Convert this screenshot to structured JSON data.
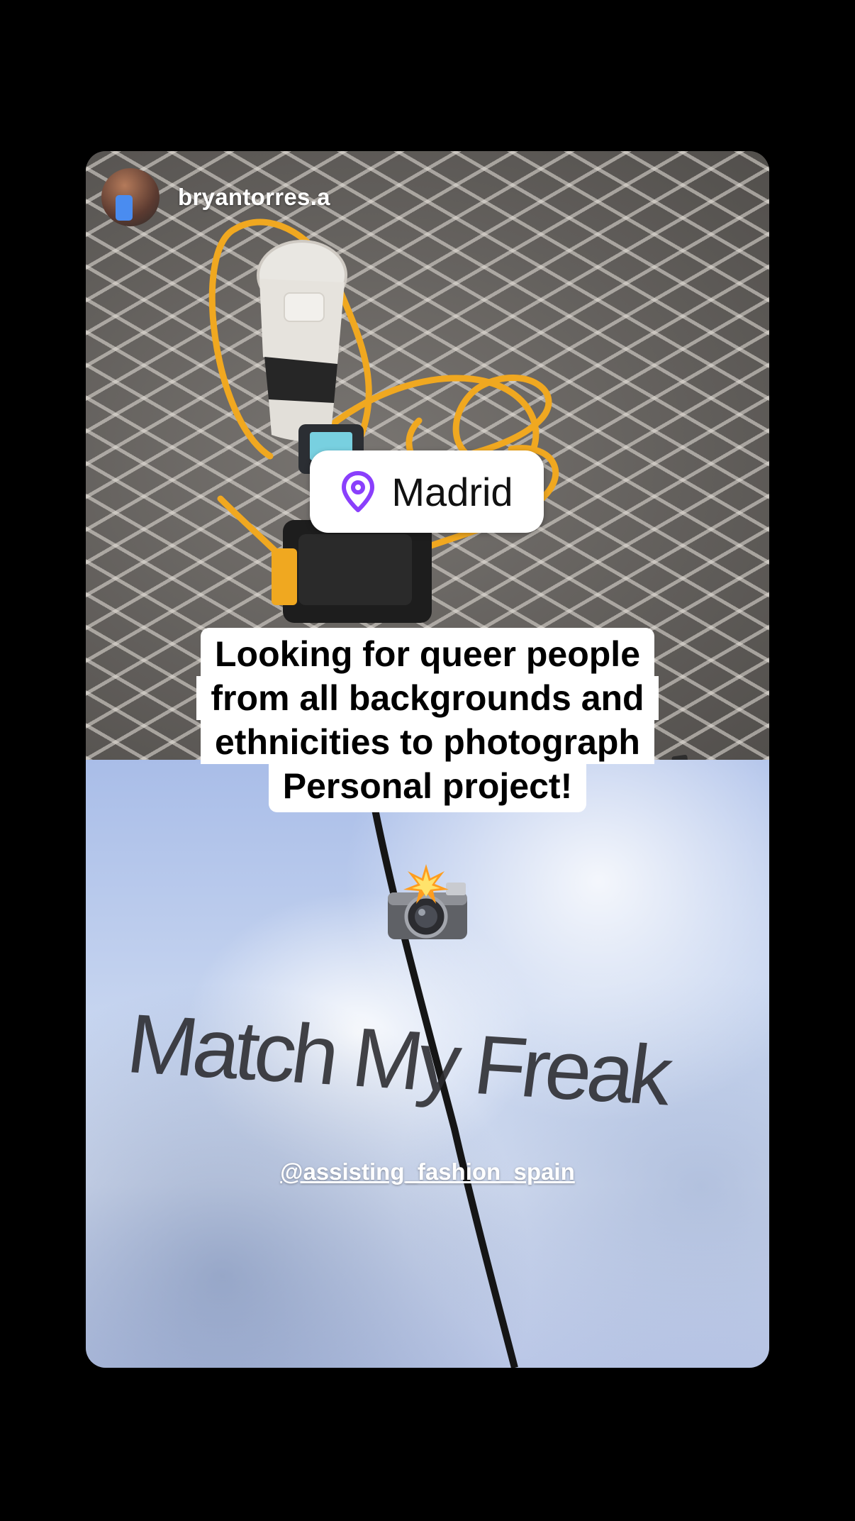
{
  "story": {
    "username": "bryantorres.a",
    "location": "Madrid",
    "caption_lines": [
      "Looking for queer people",
      "from all backgrounds and",
      "ethnicities to photograph",
      "Personal project!"
    ],
    "shirt_text": "Match My Freak",
    "mention": "@assisting_fashion_spain",
    "emoji": "camera-with-flash"
  },
  "colors": {
    "background": "#000000",
    "location_pin": "#8a3ffc",
    "cable": "#f0a820",
    "caption_bg": "#ffffff"
  }
}
